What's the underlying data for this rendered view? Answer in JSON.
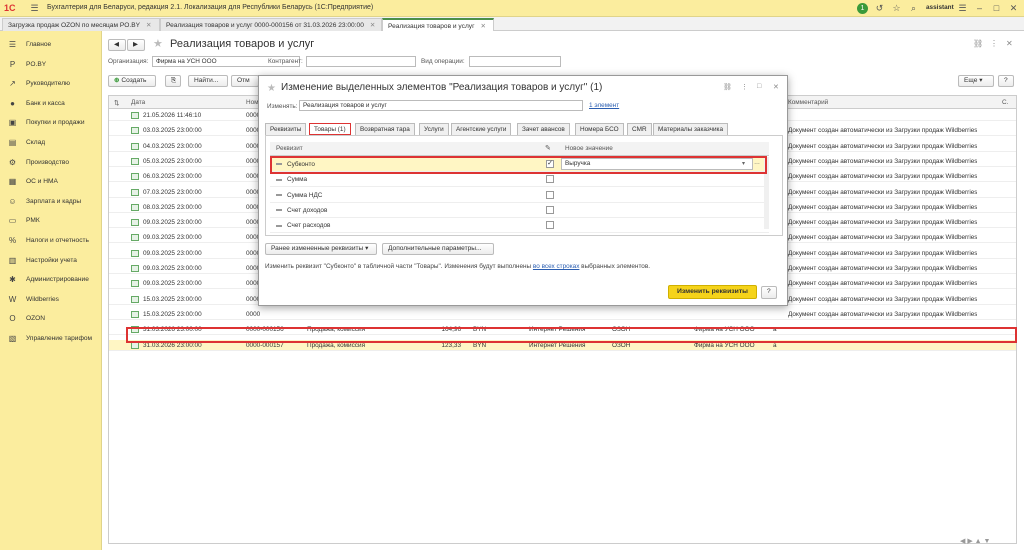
{
  "app": {
    "title": "Бухгалтерия для Беларуси, редакция 2.1. Локализация для Республики Беларусь   (1С:Предприятие)",
    "user": "assistant",
    "notif_count": "1"
  },
  "open_tabs": [
    {
      "label": "Загрузка продаж OZON по месяцам PO.BY"
    },
    {
      "label": "Реализация товаров и услуг 0000-000156 от 31.03.2026 23:00:00"
    },
    {
      "label": "Реализация товаров и услуг"
    }
  ],
  "sidebar": {
    "items": [
      {
        "label": "Главное",
        "icon": "☰"
      },
      {
        "label": "PO.BY",
        "icon": "P"
      },
      {
        "label": "Руководителю",
        "icon": "↗"
      },
      {
        "label": "Банк и касса",
        "icon": "●"
      },
      {
        "label": "Покупки и продажи",
        "icon": "▣"
      },
      {
        "label": "Склад",
        "icon": "▤"
      },
      {
        "label": "Производство",
        "icon": "⚙"
      },
      {
        "label": "ОС и НМА",
        "icon": "▦"
      },
      {
        "label": "Зарплата и кадры",
        "icon": "☺"
      },
      {
        "label": "РМК",
        "icon": "▭"
      },
      {
        "label": "Налоги и отчетность",
        "icon": "%"
      },
      {
        "label": "Настройки учета",
        "icon": "▥"
      },
      {
        "label": "Администрирование",
        "icon": "✱"
      },
      {
        "label": "Wildberries",
        "icon": "W"
      },
      {
        "label": "OZON",
        "icon": "O"
      },
      {
        "label": "Управление тарифом",
        "icon": "▧"
      }
    ]
  },
  "page": {
    "title": "Реализация товаров и услуг",
    "org_label": "Организация:",
    "org_value": "Фирма на УСН ООО",
    "counterparty_label": "Контрагент:",
    "optype_label": "Вид операции:",
    "create_label": "Создать",
    "find_label": "Найти...",
    "cancel_search_label": "Отм",
    "more_label": "Еще"
  },
  "grid": {
    "headers": {
      "date": "Дата",
      "number": "Ном",
      "comment": "Комментарий",
      "c": "С."
    },
    "rows": [
      {
        "date": "21.05.2026 11:46:10",
        "number": "0000",
        "comment": "",
        "kind": "",
        "amount": "",
        "cur": "",
        "contractor": "",
        "partner": "",
        "org": "",
        "a": ""
      },
      {
        "date": "03.03.2025 23:00:00",
        "number": "0000",
        "comment": "Документ создан автоматически из Загрузки продаж Wildberries",
        "kind": "",
        "amount": "",
        "cur": "",
        "contractor": "",
        "partner": "",
        "org": "",
        "a": ""
      },
      {
        "date": "04.03.2025 23:00:00",
        "number": "0000",
        "comment": "Документ создан автоматически из Загрузки продаж Wildberries",
        "kind": "",
        "amount": "",
        "cur": "",
        "contractor": "",
        "partner": "",
        "org": "",
        "a": ""
      },
      {
        "date": "05.03.2025 23:00:00",
        "number": "0000",
        "comment": "Документ создан автоматически из Загрузки продаж Wildberries",
        "kind": "",
        "amount": "",
        "cur": "",
        "contractor": "",
        "partner": "",
        "org": "",
        "a": ""
      },
      {
        "date": "06.03.2025 23:00:00",
        "number": "0000",
        "comment": "Документ создан автоматически из Загрузки продаж Wildberries",
        "kind": "",
        "amount": "",
        "cur": "",
        "contractor": "",
        "partner": "",
        "org": "",
        "a": ""
      },
      {
        "date": "07.03.2025 23:00:00",
        "number": "0000",
        "comment": "Документ создан автоматически из Загрузки продаж Wildberries",
        "kind": "",
        "amount": "",
        "cur": "",
        "contractor": "",
        "partner": "",
        "org": "",
        "a": ""
      },
      {
        "date": "08.03.2025 23:00:00",
        "number": "0000",
        "comment": "Документ создан автоматически из Загрузки продаж Wildberries",
        "kind": "",
        "amount": "",
        "cur": "",
        "contractor": "",
        "partner": "",
        "org": "",
        "a": ""
      },
      {
        "date": "09.03.2025 23:00:00",
        "number": "0000",
        "comment": "Документ создан автоматически из Загрузки продаж Wildberries",
        "kind": "",
        "amount": "",
        "cur": "",
        "contractor": "",
        "partner": "",
        "org": "",
        "a": ""
      },
      {
        "date": "09.03.2025 23:00:00",
        "number": "0000",
        "comment": "Документ создан автоматически из Загрузки продаж Wildberries",
        "kind": "",
        "amount": "",
        "cur": "",
        "contractor": "",
        "partner": "",
        "org": "",
        "a": ""
      },
      {
        "date": "09.03.2025 23:00:00",
        "number": "0000",
        "comment": "Документ создан автоматически из Загрузки продаж Wildberries",
        "kind": "",
        "amount": "",
        "cur": "",
        "contractor": "",
        "partner": "",
        "org": "",
        "a": ""
      },
      {
        "date": "09.03.2025 23:00:00",
        "number": "0000",
        "comment": "Документ создан автоматически из Загрузки продаж Wildberries",
        "kind": "",
        "amount": "",
        "cur": "",
        "contractor": "",
        "partner": "",
        "org": "",
        "a": ""
      },
      {
        "date": "09.03.2025 23:00:00",
        "number": "0000",
        "comment": "Документ создан автоматически из Загрузки продаж Wildberries",
        "kind": "",
        "amount": "",
        "cur": "",
        "contractor": "",
        "partner": "",
        "org": "",
        "a": ""
      },
      {
        "date": "15.03.2025 23:00:00",
        "number": "0000",
        "comment": "Документ создан автоматически из Загрузки продаж Wildberries",
        "kind": "",
        "amount": "",
        "cur": "",
        "contractor": "",
        "partner": "",
        "org": "",
        "a": ""
      },
      {
        "date": "15.03.2025 23:00:00",
        "number": "0000",
        "comment": "Документ создан автоматически из Загрузки продаж Wildberries",
        "kind": "",
        "amount": "",
        "cur": "",
        "contractor": "",
        "partner": "",
        "org": "",
        "a": ""
      },
      {
        "date": "31.03.2026 23:00:00",
        "number": "0000-000156",
        "comment": "",
        "kind": "Продажа, комиссия",
        "amount": "164,96",
        "cur": "BYN",
        "contractor": "Интернет Решения",
        "partner": "ОЗОН",
        "org": "Фирма на УСН ООО",
        "a": "a"
      },
      {
        "date": "31.03.2026 23:00:00",
        "number": "0000-000157",
        "comment": "",
        "kind": "Продажа, комиссия",
        "amount": "123,33",
        "cur": "BYN",
        "contractor": "Интернет Решения",
        "partner": "ОЗОН",
        "org": "Фирма на УСН ООО",
        "a": "a"
      }
    ]
  },
  "dialog": {
    "title": "Изменение выделенных элементов \"Реализация товаров и услуг\" (1)",
    "change_label": "Изменять:",
    "change_value": "Реализация товаров и услуг",
    "count_link": "1 элемент",
    "tabs": [
      "Реквизиты",
      "Товары (1)",
      "Возвратная тара",
      "Услуги",
      "Агентские услуги",
      "Зачет авансов",
      "Номера БСО",
      "CMR",
      "Материалы заказчика"
    ],
    "col_prop": "Реквизит",
    "col_new": "Новое значение",
    "props": [
      {
        "name": "Субконто",
        "checked": "✓",
        "value": "Выручка"
      },
      {
        "name": "Сумма",
        "checked": "",
        "value": ""
      },
      {
        "name": "Сумма НДС",
        "checked": "",
        "value": ""
      },
      {
        "name": "Счет доходов",
        "checked": "",
        "value": ""
      },
      {
        "name": "Счет расходов",
        "checked": "",
        "value": ""
      }
    ],
    "prev_btn": "Ранее измененные реквизиты",
    "extra_btn": "Дополнительные параметры...",
    "info_before": "Изменить реквизит \"Субконто\" в табличной части \"Товары\". Изменения будут выполнены ",
    "info_link": "во всех строках",
    "info_after": " выбранных элементов.",
    "apply_btn": "Изменить реквизиты",
    "help_btn": "?"
  },
  "colors": {
    "accent_yellow": "#fbed9e",
    "highlight_red": "#d33333",
    "apply_btn": "#f5d31a"
  }
}
